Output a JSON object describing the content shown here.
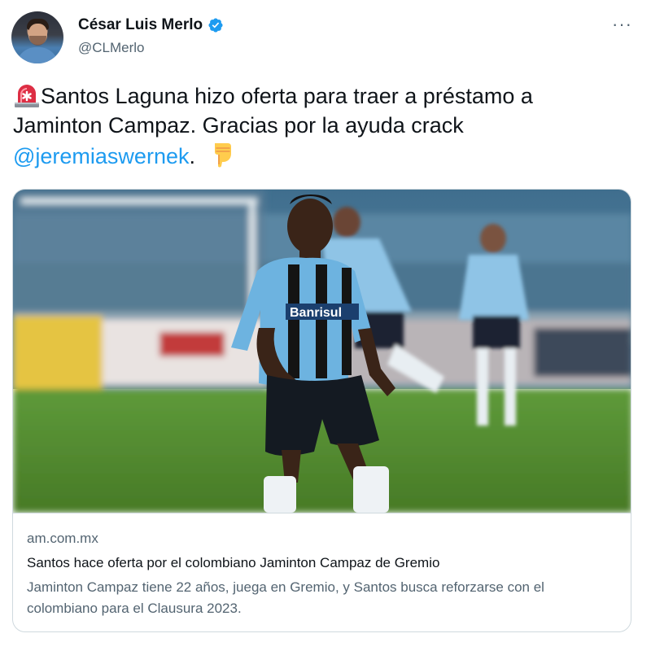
{
  "author": {
    "display_name": "César Luis Merlo",
    "handle": "@CLMerlo",
    "verified": true,
    "avatar_icon": "profile-photo"
  },
  "tweet": {
    "leading_emoji": "rotating-light-emoji",
    "text_line_1": "Santos Laguna hizo oferta para traer a préstamo a",
    "text_line_2": "Jaminton Campaz. Gracias por la ayuda crack",
    "mention": "@jeremiaswernek",
    "after_mention": ".",
    "trailing_emoji": "pointing-down-emoji"
  },
  "link_card": {
    "image_subject": "soccer-player-photo",
    "image_sponsor_text": "Banrisul",
    "domain": "am.com.mx",
    "title": "Santos hace oferta por el colombiano Jaminton Campaz de Gremio",
    "description": "Jaminton Campaz tiene 22 años, juega en Gremio, y Santos busca reforzarse con el colombiano para el Clausura 2023."
  },
  "menu": {
    "more_label": "···"
  },
  "colors": {
    "text_primary": "#0f1419",
    "text_secondary": "#536471",
    "link": "#1d9bf0",
    "border": "#cfd9de"
  }
}
